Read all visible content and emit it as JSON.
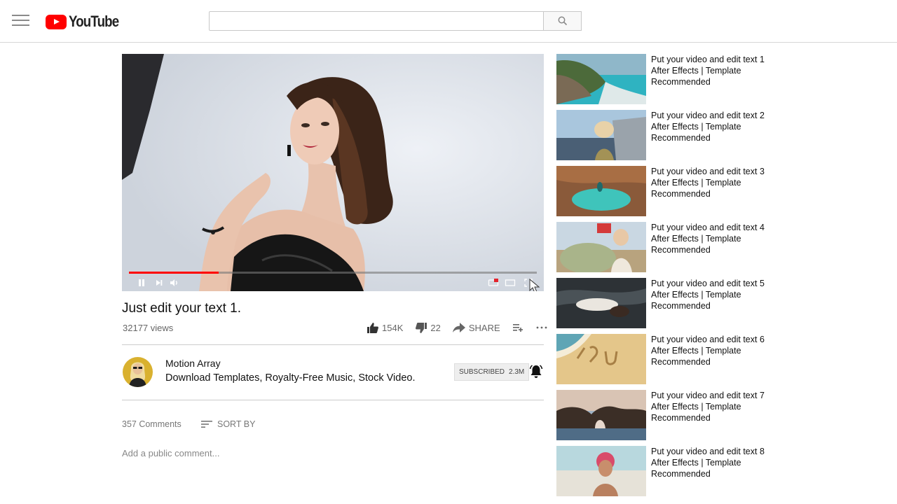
{
  "header": {
    "logo_text": "YouTube",
    "search_placeholder": "",
    "colors": {
      "brand": "#ff0000"
    }
  },
  "player": {
    "progress_fraction": 0.22,
    "icons": [
      "pause-icon",
      "next-icon",
      "volume-icon",
      "captions-icon",
      "theater-icon",
      "fullscreen-icon"
    ]
  },
  "video": {
    "title": "Just edit your text 1.",
    "views": "32177 views",
    "likes": "154K",
    "dislikes": "22",
    "share_label": "SHARE"
  },
  "channel": {
    "name": "Motion Array",
    "description": "Download Templates, Royalty-Free Music, Stock Video.",
    "subscribed_label": "SUBSCRIBED",
    "subscriber_count": "2.3M"
  },
  "comments": {
    "count_label": "357 Comments",
    "sort_label": "SORT BY",
    "add_placeholder": "Add a public comment..."
  },
  "sidebar": {
    "items": [
      {
        "title": "Put your video and edit text 1",
        "channel": "After Effects | Template",
        "meta": "Recommended"
      },
      {
        "title": "Put your video and edit text 2",
        "channel": "After Effects | Template",
        "meta": "Recommended"
      },
      {
        "title": "Put your video and edit text 3",
        "channel": "After Effects | Template",
        "meta": "Recommended"
      },
      {
        "title": "Put your video and edit text 4",
        "channel": "After Effects | Template",
        "meta": "Recommended"
      },
      {
        "title": "Put your video and edit text 5",
        "channel": "After Effects | Template",
        "meta": "Recommended"
      },
      {
        "title": "Put your video and edit text 6",
        "channel": "After Effects | Template",
        "meta": "Recommended"
      },
      {
        "title": "Put your video and edit text 7",
        "channel": "After Effects | Template",
        "meta": "Recommended"
      },
      {
        "title": "Put your video and edit text 8",
        "channel": "After Effects | Template",
        "meta": "Recommended"
      }
    ]
  }
}
